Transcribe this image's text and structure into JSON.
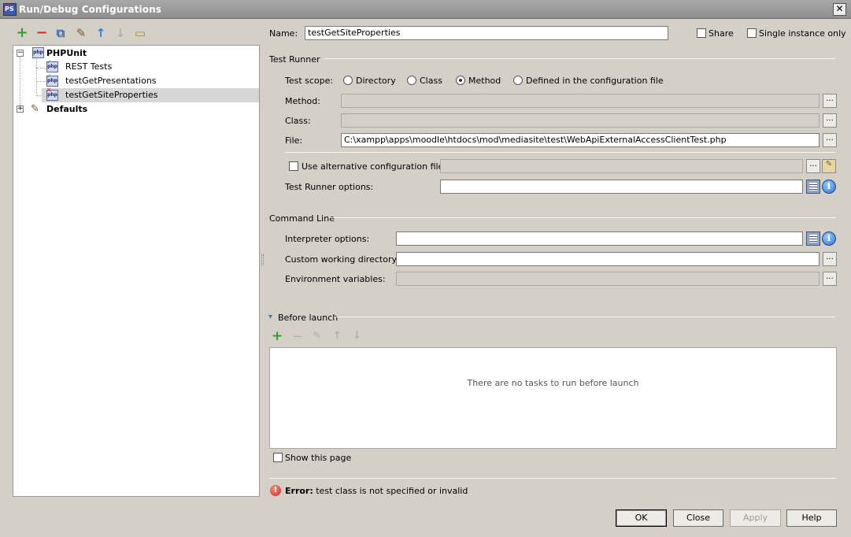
{
  "window": {
    "title": "Run/Debug Configurations",
    "close_glyph": "✕"
  },
  "left_toolbar": {
    "add": "+",
    "remove": "−",
    "copy": "⧉",
    "edit_defaults": "✎",
    "move_up": "↑",
    "move_down": "↓",
    "folder": "▭"
  },
  "tree": {
    "root": "PHPUnit",
    "items": [
      "REST Tests",
      "testGetPresentations",
      "testGetSiteProperties"
    ],
    "defaults": "Defaults",
    "expander_minus": "−",
    "expander_plus": "+"
  },
  "name": {
    "label": "Name:",
    "value": "testGetSiteProperties"
  },
  "share_label": "Share",
  "single_instance_label": "Single instance only",
  "test_runner": {
    "section": "Test Runner",
    "scope_label": "Test scope:",
    "scopes": [
      "Directory",
      "Class",
      "Method",
      "Defined in the configuration file"
    ],
    "selected_scope": "Method",
    "method_label": "Method:",
    "class_label": "Class:",
    "file_label": "File:",
    "file_value": "C:\\xampp\\apps\\moodle\\htdocs\\mod\\mediasite\\test\\WebApiExternalAccessClientTest.php",
    "alt_config_label": "Use alternative configuration file:",
    "options_label": "Test Runner options:",
    "browse": "..."
  },
  "command_line": {
    "section": "Command Line",
    "interpreter_label": "Interpreter options:",
    "working_dir_label": "Custom working directory:",
    "env_label": "Environment variables:"
  },
  "before_launch": {
    "section": "Before launch",
    "empty_text": "There are no tasks to run before launch",
    "show_page_label": "Show this page",
    "add": "+",
    "remove": "−",
    "edit": "✎",
    "up": "↑",
    "down": "↓",
    "collapse_glyph": "▾"
  },
  "error": {
    "prefix": "Error:",
    "message": " test class is not specified or invalid",
    "glyph": "!"
  },
  "buttons": {
    "ok": "OK",
    "close": "Close",
    "apply": "Apply",
    "help": "Help"
  },
  "colors": {
    "dialog_bg": "#d4d0c8",
    "title_bar": "#9a9a9a",
    "selection": "#d6d6d6",
    "add_green": "#2e9e2e",
    "remove_red": "#d03030",
    "arrow_blue": "#3a7bd5",
    "error_red": "#c62828"
  },
  "icons": {
    "php": "php"
  }
}
